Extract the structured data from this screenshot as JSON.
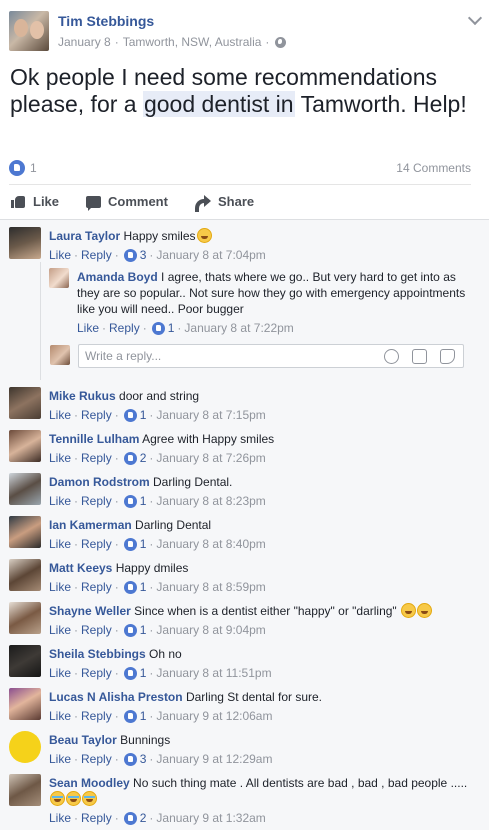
{
  "post": {
    "author": "Tim Stebbings",
    "date": "January 8",
    "separator": "·",
    "location": "Tamworth, NSW, Australia",
    "separator2": "·",
    "text_before": "Ok people I need some recommendations please, for a ",
    "text_highlight": "good dentist in",
    "text_after": " Tamworth. Help!",
    "like_count": "1",
    "comment_count": "14 Comments"
  },
  "actions": {
    "like": "Like",
    "comment": "Comment",
    "share": "Share"
  },
  "comments": [
    {
      "name": "Laura Taylor",
      "text": "Happy smiles",
      "like": "Like",
      "sep": "·",
      "reply": "Reply",
      "sep2": "·",
      "likes": "3",
      "sep3": "·",
      "time": "January 8 at 7:04pm"
    },
    {
      "name": "Mike Rukus",
      "text": "door and string",
      "like": "Like",
      "sep": "·",
      "reply": "Reply",
      "sep2": "·",
      "likes": "1",
      "sep3": "·",
      "time": "January 8 at 7:15pm"
    },
    {
      "name": "Tennille Lulham",
      "text": "Agree with Happy smiles",
      "like": "Like",
      "sep": "·",
      "reply": "Reply",
      "sep2": "·",
      "likes": "2",
      "sep3": "·",
      "time": "January 8 at 7:26pm"
    },
    {
      "name": "Damon Rodstrom",
      "text": "Darling Dental.",
      "like": "Like",
      "sep": "·",
      "reply": "Reply",
      "sep2": "·",
      "likes": "1",
      "sep3": "·",
      "time": "January 8 at 8:23pm"
    },
    {
      "name": "Ian Kamerman",
      "text": "Darling Dental",
      "like": "Like",
      "sep": "·",
      "reply": "Reply",
      "sep2": "·",
      "likes": "1",
      "sep3": "·",
      "time": "January 8 at 8:40pm"
    },
    {
      "name": "Matt Keeys",
      "text": "Happy dmiles",
      "like": "Like",
      "sep": "·",
      "reply": "Reply",
      "sep2": "·",
      "likes": "1",
      "sep3": "·",
      "time": "January 8 at 8:59pm"
    },
    {
      "name": "Shayne Weller",
      "text": "Since when is a dentist either \"happy\" or \"darling\"",
      "like": "Like",
      "sep": "·",
      "reply": "Reply",
      "sep2": "·",
      "likes": "1",
      "sep3": "·",
      "time": "January 8 at 9:04pm"
    },
    {
      "name": "Sheila Stebbings",
      "text": "Oh no",
      "like": "Like",
      "sep": "·",
      "reply": "Reply",
      "sep2": "·",
      "likes": "1",
      "sep3": "·",
      "time": "January 8 at 11:51pm"
    },
    {
      "name": "Lucas N Alisha Preston",
      "text": "Darling St dental for sure.",
      "like": "Like",
      "sep": "·",
      "reply": "Reply",
      "sep2": "·",
      "likes": "1",
      "sep3": "·",
      "time": "January 9 at 12:06am"
    },
    {
      "name": "Beau Taylor",
      "text": "Bunnings",
      "like": "Like",
      "sep": "·",
      "reply": "Reply",
      "sep2": "·",
      "likes": "3",
      "sep3": "·",
      "time": "January 9 at 12:29am"
    },
    {
      "name": "Sean Moodley",
      "text": "No such thing mate . All dentists are bad , bad , bad people .....",
      "like": "Like",
      "sep": "·",
      "reply": "Reply",
      "sep2": "·",
      "likes": "2",
      "sep3": "·",
      "time": "January 9 at 1:32am"
    }
  ],
  "reply": {
    "name": "Amanda Boyd",
    "text": "I agree, thats where we go.. But very hard to get into as they are so popular.. Not sure how they go with emergency appointments like you will need.. Poor bugger",
    "like": "Like",
    "sep": "·",
    "reply": "Reply",
    "sep2": "·",
    "likes": "1",
    "sep3": "·",
    "time": "January 8 at 7:22pm"
  },
  "reply_input": {
    "placeholder": "Write a reply..."
  },
  "colors": {
    "link": "#365899",
    "meta": "#90949c",
    "like_badge": "#4d78d1",
    "background": "#f6f7f9"
  }
}
